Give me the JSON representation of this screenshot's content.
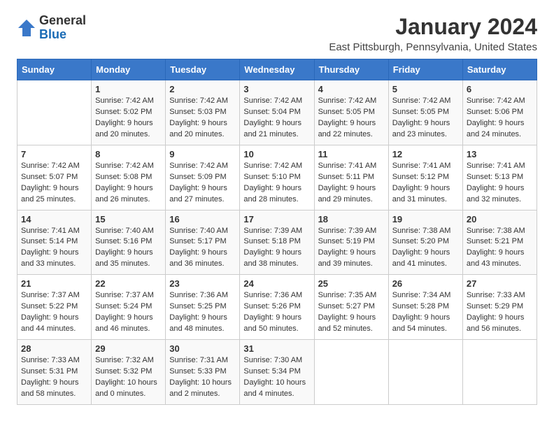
{
  "header": {
    "logo_general": "General",
    "logo_blue": "Blue",
    "month_title": "January 2024",
    "location": "East Pittsburgh, Pennsylvania, United States"
  },
  "weekdays": [
    "Sunday",
    "Monday",
    "Tuesday",
    "Wednesday",
    "Thursday",
    "Friday",
    "Saturday"
  ],
  "weeks": [
    [
      {
        "day": "",
        "sunrise": "",
        "sunset": "",
        "daylight": ""
      },
      {
        "day": "1",
        "sunrise": "Sunrise: 7:42 AM",
        "sunset": "Sunset: 5:02 PM",
        "daylight": "Daylight: 9 hours and 20 minutes."
      },
      {
        "day": "2",
        "sunrise": "Sunrise: 7:42 AM",
        "sunset": "Sunset: 5:03 PM",
        "daylight": "Daylight: 9 hours and 20 minutes."
      },
      {
        "day": "3",
        "sunrise": "Sunrise: 7:42 AM",
        "sunset": "Sunset: 5:04 PM",
        "daylight": "Daylight: 9 hours and 21 minutes."
      },
      {
        "day": "4",
        "sunrise": "Sunrise: 7:42 AM",
        "sunset": "Sunset: 5:05 PM",
        "daylight": "Daylight: 9 hours and 22 minutes."
      },
      {
        "day": "5",
        "sunrise": "Sunrise: 7:42 AM",
        "sunset": "Sunset: 5:05 PM",
        "daylight": "Daylight: 9 hours and 23 minutes."
      },
      {
        "day": "6",
        "sunrise": "Sunrise: 7:42 AM",
        "sunset": "Sunset: 5:06 PM",
        "daylight": "Daylight: 9 hours and 24 minutes."
      }
    ],
    [
      {
        "day": "7",
        "sunrise": "Sunrise: 7:42 AM",
        "sunset": "Sunset: 5:07 PM",
        "daylight": "Daylight: 9 hours and 25 minutes."
      },
      {
        "day": "8",
        "sunrise": "Sunrise: 7:42 AM",
        "sunset": "Sunset: 5:08 PM",
        "daylight": "Daylight: 9 hours and 26 minutes."
      },
      {
        "day": "9",
        "sunrise": "Sunrise: 7:42 AM",
        "sunset": "Sunset: 5:09 PM",
        "daylight": "Daylight: 9 hours and 27 minutes."
      },
      {
        "day": "10",
        "sunrise": "Sunrise: 7:42 AM",
        "sunset": "Sunset: 5:10 PM",
        "daylight": "Daylight: 9 hours and 28 minutes."
      },
      {
        "day": "11",
        "sunrise": "Sunrise: 7:41 AM",
        "sunset": "Sunset: 5:11 PM",
        "daylight": "Daylight: 9 hours and 29 minutes."
      },
      {
        "day": "12",
        "sunrise": "Sunrise: 7:41 AM",
        "sunset": "Sunset: 5:12 PM",
        "daylight": "Daylight: 9 hours and 31 minutes."
      },
      {
        "day": "13",
        "sunrise": "Sunrise: 7:41 AM",
        "sunset": "Sunset: 5:13 PM",
        "daylight": "Daylight: 9 hours and 32 minutes."
      }
    ],
    [
      {
        "day": "14",
        "sunrise": "Sunrise: 7:41 AM",
        "sunset": "Sunset: 5:14 PM",
        "daylight": "Daylight: 9 hours and 33 minutes."
      },
      {
        "day": "15",
        "sunrise": "Sunrise: 7:40 AM",
        "sunset": "Sunset: 5:16 PM",
        "daylight": "Daylight: 9 hours and 35 minutes."
      },
      {
        "day": "16",
        "sunrise": "Sunrise: 7:40 AM",
        "sunset": "Sunset: 5:17 PM",
        "daylight": "Daylight: 9 hours and 36 minutes."
      },
      {
        "day": "17",
        "sunrise": "Sunrise: 7:39 AM",
        "sunset": "Sunset: 5:18 PM",
        "daylight": "Daylight: 9 hours and 38 minutes."
      },
      {
        "day": "18",
        "sunrise": "Sunrise: 7:39 AM",
        "sunset": "Sunset: 5:19 PM",
        "daylight": "Daylight: 9 hours and 39 minutes."
      },
      {
        "day": "19",
        "sunrise": "Sunrise: 7:38 AM",
        "sunset": "Sunset: 5:20 PM",
        "daylight": "Daylight: 9 hours and 41 minutes."
      },
      {
        "day": "20",
        "sunrise": "Sunrise: 7:38 AM",
        "sunset": "Sunset: 5:21 PM",
        "daylight": "Daylight: 9 hours and 43 minutes."
      }
    ],
    [
      {
        "day": "21",
        "sunrise": "Sunrise: 7:37 AM",
        "sunset": "Sunset: 5:22 PM",
        "daylight": "Daylight: 9 hours and 44 minutes."
      },
      {
        "day": "22",
        "sunrise": "Sunrise: 7:37 AM",
        "sunset": "Sunset: 5:24 PM",
        "daylight": "Daylight: 9 hours and 46 minutes."
      },
      {
        "day": "23",
        "sunrise": "Sunrise: 7:36 AM",
        "sunset": "Sunset: 5:25 PM",
        "daylight": "Daylight: 9 hours and 48 minutes."
      },
      {
        "day": "24",
        "sunrise": "Sunrise: 7:36 AM",
        "sunset": "Sunset: 5:26 PM",
        "daylight": "Daylight: 9 hours and 50 minutes."
      },
      {
        "day": "25",
        "sunrise": "Sunrise: 7:35 AM",
        "sunset": "Sunset: 5:27 PM",
        "daylight": "Daylight: 9 hours and 52 minutes."
      },
      {
        "day": "26",
        "sunrise": "Sunrise: 7:34 AM",
        "sunset": "Sunset: 5:28 PM",
        "daylight": "Daylight: 9 hours and 54 minutes."
      },
      {
        "day": "27",
        "sunrise": "Sunrise: 7:33 AM",
        "sunset": "Sunset: 5:29 PM",
        "daylight": "Daylight: 9 hours and 56 minutes."
      }
    ],
    [
      {
        "day": "28",
        "sunrise": "Sunrise: 7:33 AM",
        "sunset": "Sunset: 5:31 PM",
        "daylight": "Daylight: 9 hours and 58 minutes."
      },
      {
        "day": "29",
        "sunrise": "Sunrise: 7:32 AM",
        "sunset": "Sunset: 5:32 PM",
        "daylight": "Daylight: 10 hours and 0 minutes."
      },
      {
        "day": "30",
        "sunrise": "Sunrise: 7:31 AM",
        "sunset": "Sunset: 5:33 PM",
        "daylight": "Daylight: 10 hours and 2 minutes."
      },
      {
        "day": "31",
        "sunrise": "Sunrise: 7:30 AM",
        "sunset": "Sunset: 5:34 PM",
        "daylight": "Daylight: 10 hours and 4 minutes."
      },
      {
        "day": "",
        "sunrise": "",
        "sunset": "",
        "daylight": ""
      },
      {
        "day": "",
        "sunrise": "",
        "sunset": "",
        "daylight": ""
      },
      {
        "day": "",
        "sunrise": "",
        "sunset": "",
        "daylight": ""
      }
    ]
  ]
}
